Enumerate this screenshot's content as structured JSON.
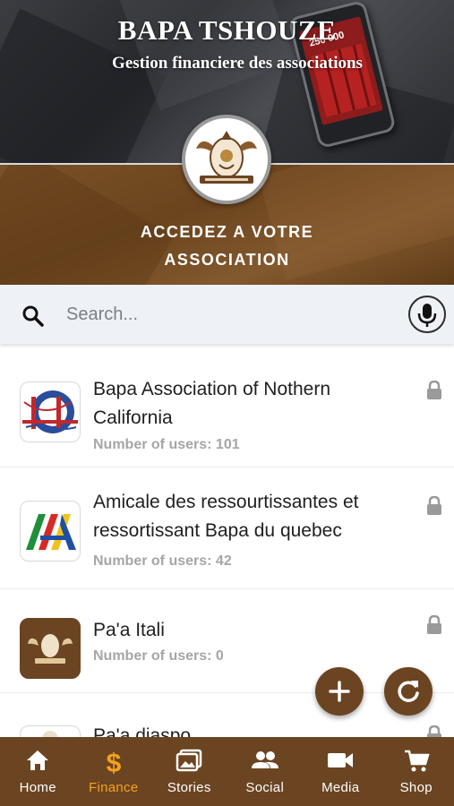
{
  "header": {
    "title": "BAPA TSHOUZE",
    "subtitle": "Gestion financiere des associations",
    "phone_amount": "250 000"
  },
  "banner": {
    "text": "ACCEDEZ A VOTRE ASSOCIATION",
    "logo_icon": "association-crest-icon"
  },
  "search": {
    "placeholder": "Search...",
    "value": ""
  },
  "associations": [
    {
      "name": "Bapa Association of Nothern California",
      "users": "Number of users: 101",
      "icon": "golden-gate-logo-icon"
    },
    {
      "name": "Amicale des ressourtissantes et ressortissant Bapa du quebec",
      "users": "Number of users: 42",
      "icon": "flag-a-logo-icon"
    },
    {
      "name": "Pa'a Itali",
      "users": "Number of users: 0",
      "icon": "crest-logo-icon"
    },
    {
      "name": "Pa'a diaspo",
      "users": "",
      "icon": "crest-logo-icon"
    }
  ],
  "nav": {
    "items": [
      {
        "label": "Home",
        "icon": "home-icon"
      },
      {
        "label": "Finance",
        "icon": "dollar-icon"
      },
      {
        "label": "Stories",
        "icon": "photos-icon"
      },
      {
        "label": "Social",
        "icon": "people-icon"
      },
      {
        "label": "Media",
        "icon": "video-icon"
      },
      {
        "label": "Shop",
        "icon": "cart-icon"
      }
    ],
    "active": "Finance"
  },
  "colors": {
    "brand_brown": "#6b4421",
    "active_nav": "#f4a21c"
  }
}
